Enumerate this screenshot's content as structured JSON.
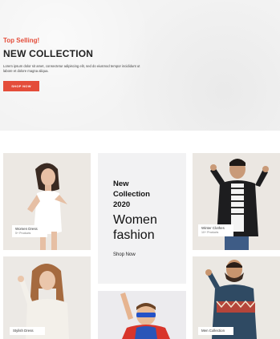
{
  "hero": {
    "eyebrow": "Top Selling!",
    "title": "NEW COLLECTION",
    "description": "Lorem ipsum dolor sit amet, consectetur adipiscing elit, sed do eiusmod tempor incididunt ut labore et dolore magna aliqua.",
    "button_label": "SHOP NOW"
  },
  "categories": [
    {
      "name": "Women Dress",
      "count": "5+ Products"
    },
    {
      "name": "Winter Clothes",
      "count": "10+ Products"
    },
    {
      "name": "Stylish Dress",
      "count": ""
    },
    {
      "name": "Men Collection",
      "count": ""
    }
  ],
  "promo": {
    "title": "New\nCollection\n2020",
    "big_text": "Women\nfashion",
    "link_label": "Shop Now"
  },
  "colors": {
    "accent": "#e44d3a",
    "hero_bg": "#f3f3f3",
    "card_bg": "#ece9e4",
    "promo_bg": "#f2f2f3"
  }
}
